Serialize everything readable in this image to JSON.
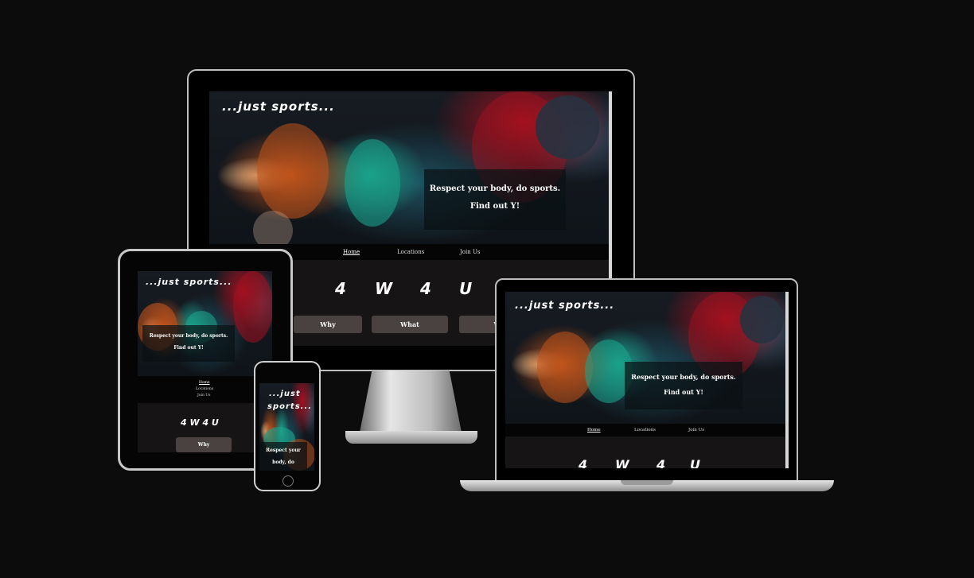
{
  "site": {
    "logo": "...just sports...",
    "logo_short_1": "...just",
    "logo_short_2": "sports...",
    "tagline_1": "Respect your body, do sports.",
    "tagline_2": "Find out Y!",
    "mobile_tag_1": "Respect your",
    "mobile_tag_2": "body, do",
    "nav": [
      "Home",
      "Locations",
      "Join Us"
    ],
    "letters": [
      "4",
      "W",
      "4",
      "U"
    ],
    "letters_compact": "4 W 4 U",
    "buttons": [
      "Why",
      "What",
      "W"
    ]
  },
  "colors": {
    "background": "#0d0c0d",
    "button": "#4a4141",
    "nav": "#050505",
    "accent_teal": "#1aa28a",
    "accent_orange": "#c0541c",
    "accent_red": "#a31120"
  }
}
